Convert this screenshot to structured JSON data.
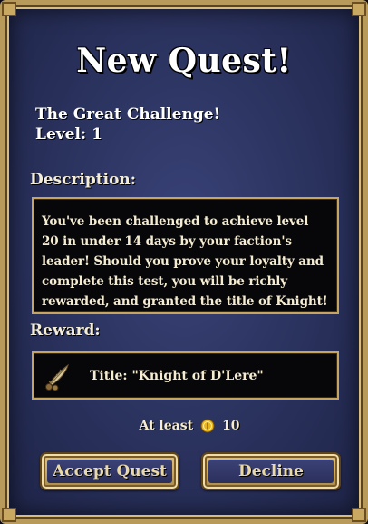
{
  "dialog": {
    "title": "New Quest!",
    "quest_name": "The Great Challenge!",
    "quest_level": "Level: 1",
    "description_label": "Description:",
    "description_text": "You've been challenged to achieve level 20 in under 14 days by your faction's leader! Should you prove your loyalty and complete this test, you will be richly rewarded, and granted the title of Knight!",
    "reward_label": "Reward:",
    "reward": {
      "icon": "quill-feather-icon",
      "text": "Title: \"Knight of D'Lere\""
    },
    "cost": {
      "prefix": "At least",
      "icon": "gold-coin-icon",
      "amount": "10"
    },
    "buttons": {
      "accept": "Accept Quest",
      "decline": "Decline"
    }
  },
  "colors": {
    "panel_blue": "#2c3461",
    "gold_border": "#c8a55c",
    "text_cream": "#f6ecd0"
  }
}
